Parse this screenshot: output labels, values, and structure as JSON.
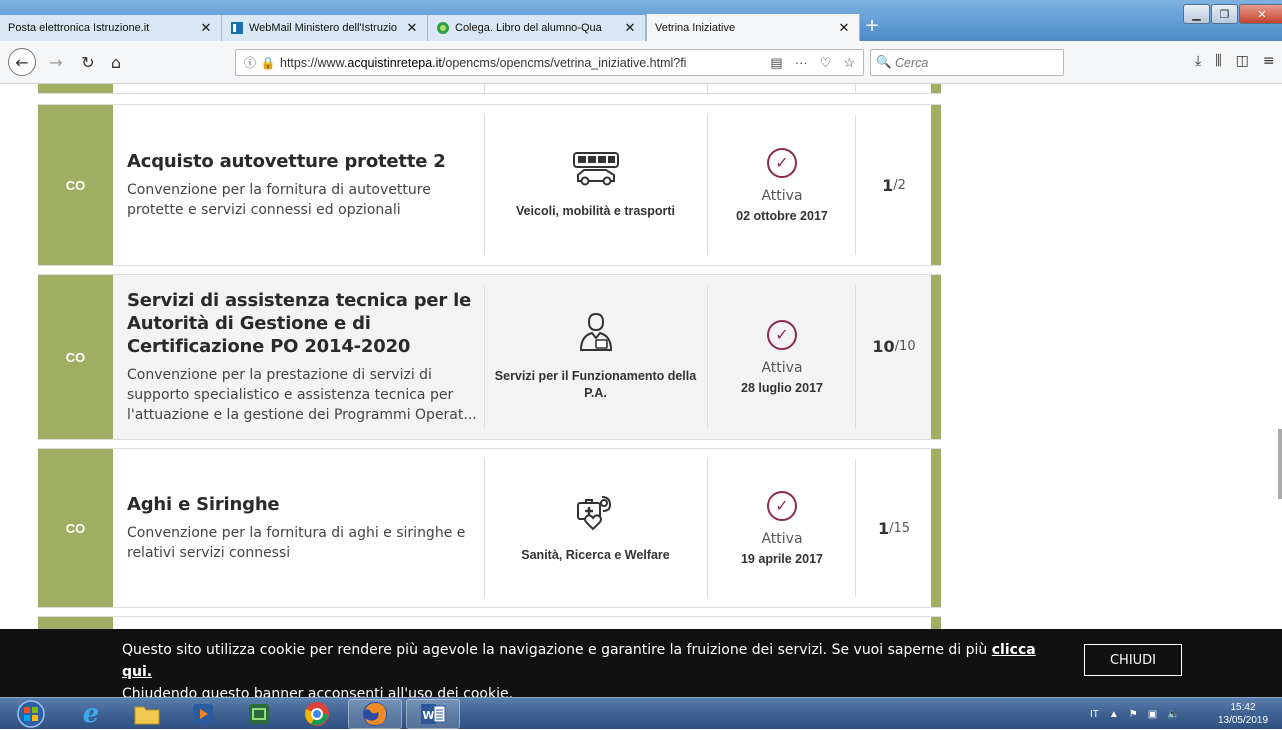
{
  "browser": {
    "tabs": [
      {
        "label": "Posta elettronica Istruzione.it",
        "active": false
      },
      {
        "label": "WebMail Ministero dell'Istruzio",
        "active": false
      },
      {
        "label": "Colega. Libro del alumno-Qua",
        "active": false
      },
      {
        "label": "Vetrina Iniziative",
        "active": true
      }
    ],
    "url_prefix": "https://www.",
    "url_domain": "acquistinretepa.it",
    "url_path": "/opencms/opencms/vetrina_iniziative.html?fi",
    "search_placeholder": "Cerca"
  },
  "initiatives": [
    {
      "badge": "CO",
      "title": "Acquisto autovetture protette 2",
      "description": "Convenzione per la fornitura di autovetture protette e servizi connessi ed opzionali",
      "category": "Veicoli, mobilità e trasporti",
      "category_icon": "vehicles-icon",
      "status": "Attiva",
      "date": "02 ottobre 2017",
      "lot_current": "1",
      "lot_total": "/2"
    },
    {
      "badge": "CO",
      "title": "Servizi di assistenza tecnica per le Autorità di Gestione e di Certificazione PO 2014-2020",
      "description": "Convenzione per la prestazione di servizi di supporto specialistico e assistenza tecnica per l'attuazione e la gestione dei Programmi Operat...",
      "category": "Servizi per il Funzionamento della P.A.",
      "category_icon": "public-services-icon",
      "status": "Attiva",
      "date": "28 luglio 2017",
      "lot_current": "10",
      "lot_total": "/10"
    },
    {
      "badge": "CO",
      "title": "Aghi e Siringhe",
      "description": "Convenzione per la fornitura di aghi e siringhe e relativi servizi connessi",
      "category": "Sanità, Ricerca e Welfare",
      "category_icon": "healthcare-icon",
      "status": "Attiva",
      "date": "19 aprile 2017",
      "lot_current": "1",
      "lot_total": "/15"
    }
  ],
  "cookie_banner": {
    "text_before": "Questo sito utilizza cookie per rendere più agevole la navigazione e garantire la fruizione dei servizi. Se vuoi saperne di più ",
    "link": "clicca qui.",
    "text_after": "Chiudendo questo banner acconsenti all'uso dei cookie.",
    "button": "CHIUDI"
  },
  "taskbar": {
    "language": "IT",
    "time": "15:42",
    "date": "13/05/2019"
  },
  "colors": {
    "accent_green": "#9fae62",
    "status_purple": "#8c2a55",
    "banner_bg": "#111111"
  }
}
